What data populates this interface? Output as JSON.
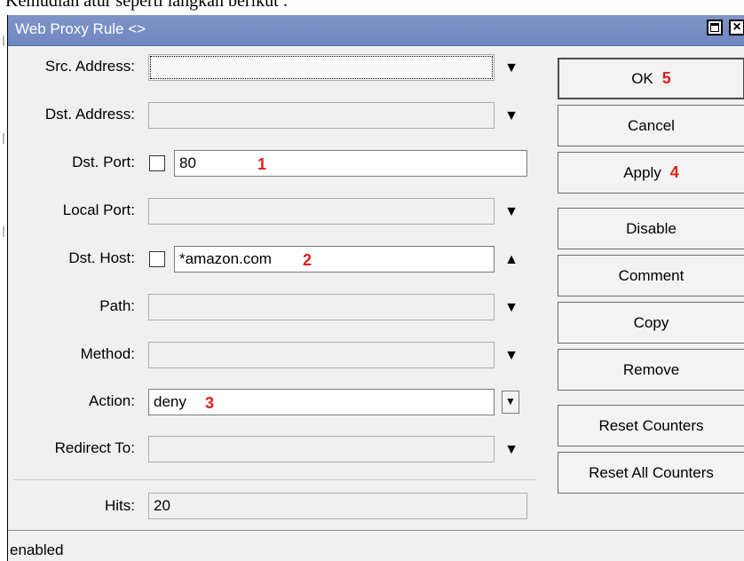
{
  "document": {
    "caption": "Kemudian atur seperti langkah berikut :"
  },
  "window": {
    "title": "Web Proxy Rule <>",
    "maximize_icon": "maximize-icon",
    "close_icon": "close-icon"
  },
  "form": {
    "src_address": {
      "label": "Src. Address:",
      "value": ""
    },
    "dst_address": {
      "label": "Dst. Address:",
      "value": ""
    },
    "dst_port": {
      "label": "Dst. Port:",
      "value": "80",
      "step": "1"
    },
    "local_port": {
      "label": "Local Port:",
      "value": ""
    },
    "dst_host": {
      "label": "Dst. Host:",
      "value": "*amazon.com",
      "step": "2"
    },
    "path": {
      "label": "Path:",
      "value": ""
    },
    "method": {
      "label": "Method:",
      "value": ""
    },
    "action": {
      "label": "Action:",
      "value": "deny",
      "step": "3"
    },
    "redirect_to": {
      "label": "Redirect To:",
      "value": ""
    },
    "hits": {
      "label": "Hits:",
      "value": "20"
    }
  },
  "buttons": {
    "ok": {
      "label": "OK",
      "step": "5"
    },
    "cancel": {
      "label": "Cancel"
    },
    "apply": {
      "label": "Apply",
      "step": "4"
    },
    "disable": {
      "label": "Disable"
    },
    "comment": {
      "label": "Comment"
    },
    "copy": {
      "label": "Copy"
    },
    "remove": {
      "label": "Remove"
    },
    "reset_counters": {
      "label": "Reset Counters"
    },
    "reset_all_counters": {
      "label": "Reset All Counters"
    }
  },
  "status": {
    "text": "enabled"
  },
  "colors": {
    "titlebar": "#7388c3",
    "annotation_red": "#e0201a",
    "window_bg": "#f0f0f0"
  }
}
